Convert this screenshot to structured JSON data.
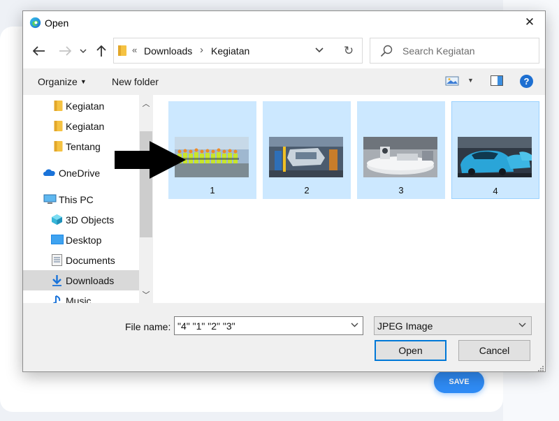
{
  "background": {
    "save_label": "SAVE"
  },
  "dialog": {
    "title": "Open",
    "address": {
      "overflow": "«",
      "crumbs": [
        "Downloads",
        "Kegiatan"
      ]
    },
    "search": {
      "placeholder": "Search Kegiatan"
    },
    "toolbar": {
      "organize_label": "Organize",
      "new_folder_label": "New folder",
      "help_label": "?"
    },
    "nav_items": [
      {
        "label": "Kegiatan",
        "icon": "folder-icon"
      },
      {
        "label": "Kegiatan",
        "icon": "folder-icon"
      },
      {
        "label": "Tentang",
        "icon": "folder-icon"
      },
      {
        "label": "OneDrive",
        "icon": "cloud-icon"
      },
      {
        "label": "This PC",
        "icon": "computer-icon"
      },
      {
        "label": "3D Objects",
        "icon": "cube-icon"
      },
      {
        "label": "Desktop",
        "icon": "desktop-icon"
      },
      {
        "label": "Documents",
        "icon": "documents-icon"
      },
      {
        "label": "Downloads",
        "icon": "download-icon",
        "selected": true
      },
      {
        "label": "Music",
        "icon": "music-icon"
      }
    ],
    "files": [
      {
        "name": "1",
        "thumbnail": "workers-in-hi-vis-vests",
        "selected": true
      },
      {
        "name": "2",
        "thumbnail": "car-assembly-line",
        "selected": true
      },
      {
        "name": "3",
        "thumbnail": "factory-turntable",
        "selected": true
      },
      {
        "name": "4",
        "thumbnail": "blue-cars-parked",
        "selected": true,
        "focused": true
      }
    ],
    "file_name_label": "File name:",
    "file_name_value": "\"4\" \"1\" \"2\" \"3\"",
    "file_type": "JPEG Image",
    "open_label": "Open",
    "cancel_label": "Cancel"
  },
  "colors": {
    "selection": "#cce8ff",
    "accent": "#0078d7",
    "save_button": "#2f8cf6"
  }
}
